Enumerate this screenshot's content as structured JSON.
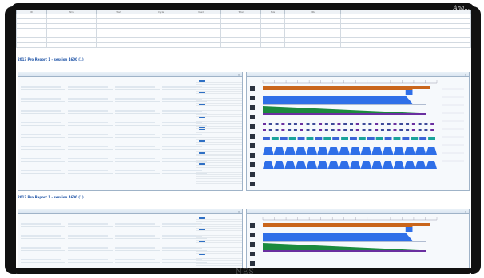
{
  "watermark_top": "Ana...",
  "watermark_bottom": "NES",
  "top_table": {
    "headers": [
      "ID",
      "Time",
      "Start",
      "Cycle",
      "Used",
      "Total",
      "Size",
      "URL",
      ""
    ],
    "rows": [
      [
        "",
        "",
        "",
        "",
        "",
        "",
        "",
        ""
      ],
      [
        "",
        "",
        "",
        "",
        "",
        "",
        "",
        ""
      ],
      [
        "",
        "",
        "",
        "",
        "",
        "",
        "",
        ""
      ],
      [
        "",
        "",
        "",
        "",
        "",
        "",
        "",
        ""
      ],
      [
        "",
        "",
        "",
        "",
        "",
        "",
        "",
        ""
      ],
      [
        "",
        "",
        "",
        "",
        "",
        "",
        "",
        ""
      ],
      [
        "",
        "",
        "",
        "",
        "",
        "",
        "",
        ""
      ]
    ]
  },
  "sections": [
    {
      "title": "2013 Pro Report  1 - session 4600 (1)",
      "lines": [
        "",
        "",
        "",
        ""
      ]
    },
    {
      "title": "2013 Pro Report  1 - session 4600 (1)",
      "lines": [
        "",
        "",
        ""
      ]
    }
  ],
  "pane_titles": {
    "form1": "",
    "timeline1": "",
    "form2": "",
    "timeline2": ""
  },
  "timeline_ticks": [
    "",
    "",
    "",
    "",
    "",
    "",
    "",
    "",
    "",
    "",
    "",
    "",
    "",
    "",
    "",
    ""
  ],
  "colors": {
    "bezel": "#111111",
    "link": "#7a58c7",
    "title_blue": "#2256a8",
    "orange": "#c9651b",
    "blue": "#2f6fe8",
    "purple": "#6a2fa0",
    "green": "#1b8a3e",
    "teal": "#1aa39a",
    "pane_border": "#9fb3c8"
  },
  "icons": [
    "close-icon"
  ]
}
